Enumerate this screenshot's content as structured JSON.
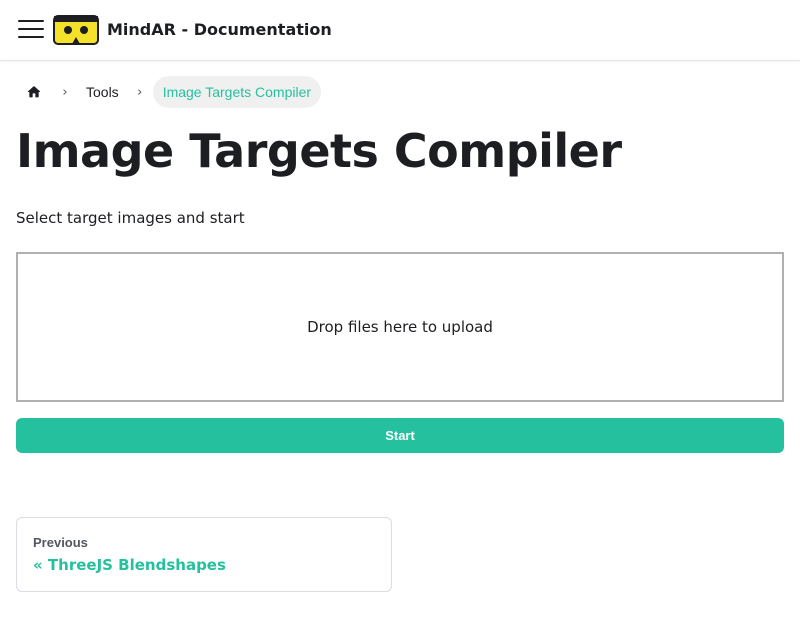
{
  "header": {
    "site_title": "MindAR - Documentation",
    "menu_icon": "hamburger-menu-icon",
    "logo_icon": "vr-headset-logo-icon"
  },
  "breadcrumb": {
    "home_icon": "home-icon",
    "separator": "›",
    "items": [
      {
        "label": "Tools"
      },
      {
        "label": "Image Targets Compiler"
      }
    ]
  },
  "main": {
    "title": "Image Targets Compiler",
    "instruction": "Select target images and start",
    "dropzone_text": "Drop files here to upload",
    "start_label": "Start"
  },
  "pagination": {
    "previous_sublabel": "Previous",
    "previous_label": "« ThreeJS Blendshapes"
  },
  "colors": {
    "accent": "#25c19f",
    "logo_yellow": "#f5e12a",
    "text": "#1c1e21"
  }
}
